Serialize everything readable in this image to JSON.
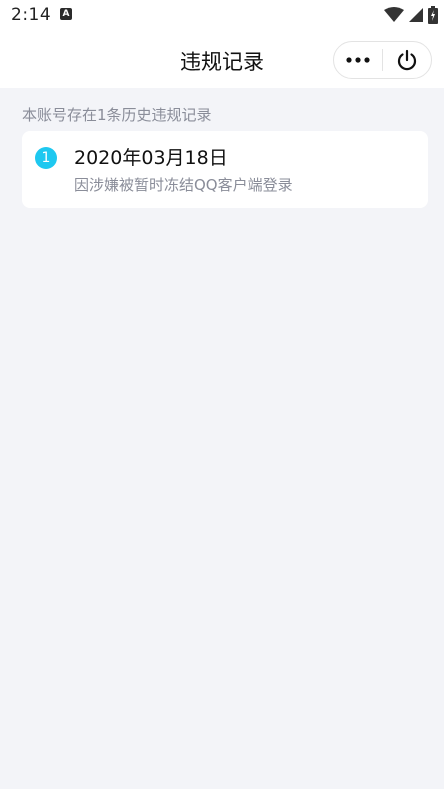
{
  "status_bar": {
    "time": "2:14",
    "app_icon_letter": "A",
    "icons": [
      "wifi-icon",
      "signal-icon",
      "battery-icon"
    ]
  },
  "nav": {
    "title": "违规记录",
    "more_icon": "more-dots-icon",
    "close_icon": "power-icon"
  },
  "notice": "本账号存在1条历史违规记录",
  "records": [
    {
      "index": "1",
      "date": "2020年03月18日",
      "description": "因涉嫌被暂时冻结QQ客户端登录"
    }
  ],
  "colors": {
    "background": "#f3f4f8",
    "badge": "#1ec8f0",
    "secondary_text": "#8a8d99"
  }
}
